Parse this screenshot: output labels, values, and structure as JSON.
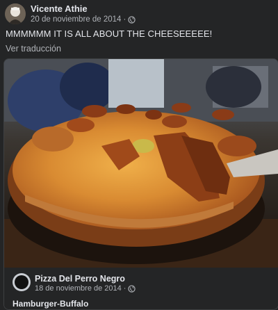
{
  "post": {
    "author": "Vicente Athie",
    "date": "20 de noviembre de 2014",
    "separator": "·",
    "audience_icon": "globe-icon",
    "text": "MMMMMM IT IS ALL ABOUT THE CHEESEEEEE!",
    "translate_link": "Ver traducción"
  },
  "shared_post": {
    "page_name": "Pizza Del Perro Negro",
    "date": "18 de noviembre de 2014",
    "separator": "·",
    "audience_icon": "globe-icon",
    "caption": "Hamburger-Buffalo",
    "photo_alt": "pizza-photo"
  },
  "colors": {
    "background": "#242526",
    "text_primary": "#e4e6eb",
    "text_secondary": "#b0b3b8"
  }
}
